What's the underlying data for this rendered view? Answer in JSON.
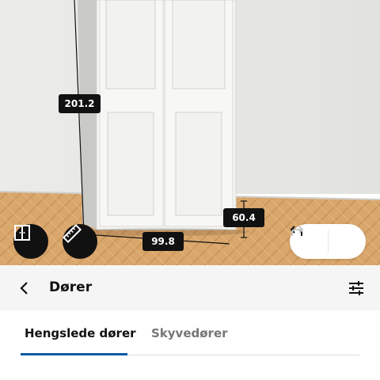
{
  "dimensions": {
    "height": "201.2",
    "width": "99.8",
    "depth": "60.4"
  },
  "tools": {
    "door_icon": "double-door-icon",
    "ruler_icon": "ruler-icon",
    "undo_icon": "undo-icon",
    "redo_icon": "redo-icon"
  },
  "header": {
    "back_icon": "chevron-left-icon",
    "title": "Dører",
    "filter_icon": "sliders-icon"
  },
  "tabs": [
    {
      "label": "Hengslede dører",
      "active": true
    },
    {
      "label": "Skyvedører",
      "active": false
    }
  ],
  "colors": {
    "accent": "#0058a3",
    "label_bg": "#111111",
    "header_bg": "#f5f5f5"
  }
}
